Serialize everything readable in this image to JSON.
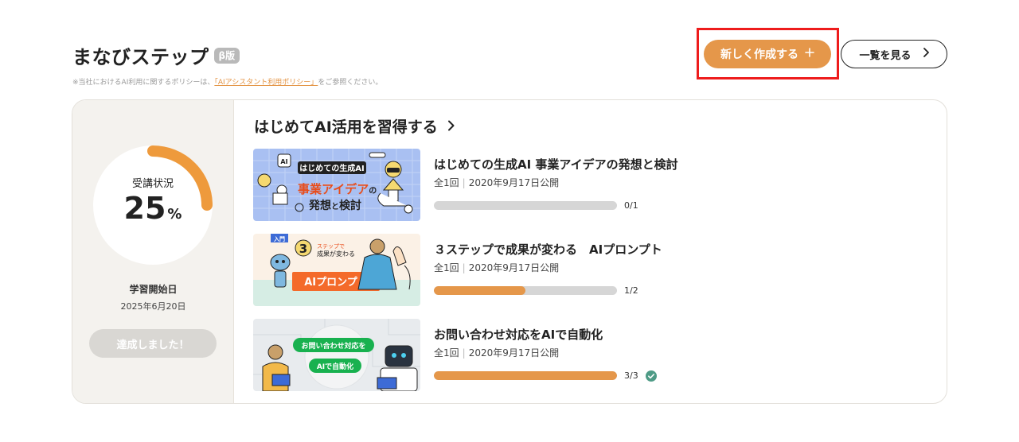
{
  "header": {
    "title": "まなびステップ",
    "beta_badge": "β版",
    "policy_prefix": "※当社におけるAI利用に関するポリシーは、",
    "policy_link": "「AIアシスタント利用ポリシー」",
    "policy_suffix": "をご参照ください。",
    "create_button": "新しく作成する",
    "create_icon": "plus-icon",
    "list_button": "一覧を見る",
    "list_icon": "chevron-right-icon"
  },
  "progress_panel": {
    "status_label": "受講状況",
    "percent_value": "25",
    "percent_unit": "%",
    "progress_fraction": 0.25,
    "start_label": "学習開始日",
    "start_date": "2025年6月20日",
    "done_button": "達成しました！"
  },
  "course": {
    "title": "はじめてAI活用を習得する",
    "title_icon": "chevron-right-icon"
  },
  "lessons": [
    {
      "title": "はじめての生成AI 事業アイデアの発想と検討",
      "count_label": "全1回",
      "published": "2020年9月17日公開",
      "progress": 0,
      "count": "0/1",
      "completed": false,
      "thumb": {
        "line1": "はじめての生成AI",
        "line2": "事業アイデア",
        "line2b": "の",
        "line3": "発想",
        "line3b": "と",
        "line3c": "検討",
        "badge": "AI"
      }
    },
    {
      "title": "３ステップで成果が変わる　AIプロンプト",
      "count_label": "全1回",
      "published": "2020年9月17日公開",
      "progress": 0.5,
      "count": "1/2",
      "completed": false,
      "thumb": {
        "tag": "入門",
        "num": "3",
        "line1": "ステップで",
        "line2": "成果が変わる",
        "banner": "AIプロンプト"
      }
    },
    {
      "title": "お問い合わせ対応をAIで自動化",
      "count_label": "全1回",
      "published": "2020年9月17日公開",
      "progress": 1,
      "count": "3/3",
      "completed": true,
      "thumb": {
        "line1": "お問い合わせ対応を",
        "line2": "AIで自動化"
      }
    }
  ],
  "colors": {
    "accent": "#e5974a",
    "highlight_border": "#ee1c1c",
    "check": "#4e9b86",
    "panel_bg": "#f4f2ee",
    "bar_track": "#d6d6d6"
  }
}
